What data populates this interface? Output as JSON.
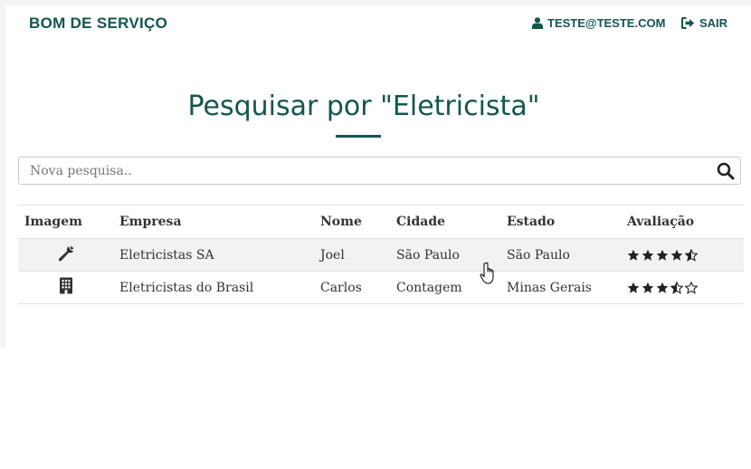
{
  "header": {
    "brand": "BOM DE SERVIÇO",
    "user_email": "TESTE@TESTE.COM",
    "user_icon": "user-icon",
    "logout_label": "SAIR",
    "logout_icon": "sign-out-icon"
  },
  "page": {
    "title": "Pesquisar por \"Eletricista\""
  },
  "search": {
    "placeholder": "Nova pesquisa..",
    "value": "",
    "icon": "search-icon"
  },
  "table": {
    "headers": [
      "Imagem",
      "Empresa",
      "Nome",
      "Cidade",
      "Estado",
      "Avaliação"
    ],
    "rows": [
      {
        "image_icon": "wrench-icon",
        "empresa": "Eletricistas SA",
        "nome": "Joel",
        "cidade": "São Paulo",
        "estado": "São Paulo",
        "avaliacao": 4.5
      },
      {
        "image_icon": "building-icon",
        "empresa": "Eletricistas do Brasil",
        "nome": "Carlos",
        "cidade": "Contagem",
        "estado": "Minas Gerais",
        "avaliacao": 3.5
      }
    ]
  },
  "colors": {
    "brand": "#13564f",
    "row_stripe": "#f2f2f2",
    "text": "#333333"
  }
}
